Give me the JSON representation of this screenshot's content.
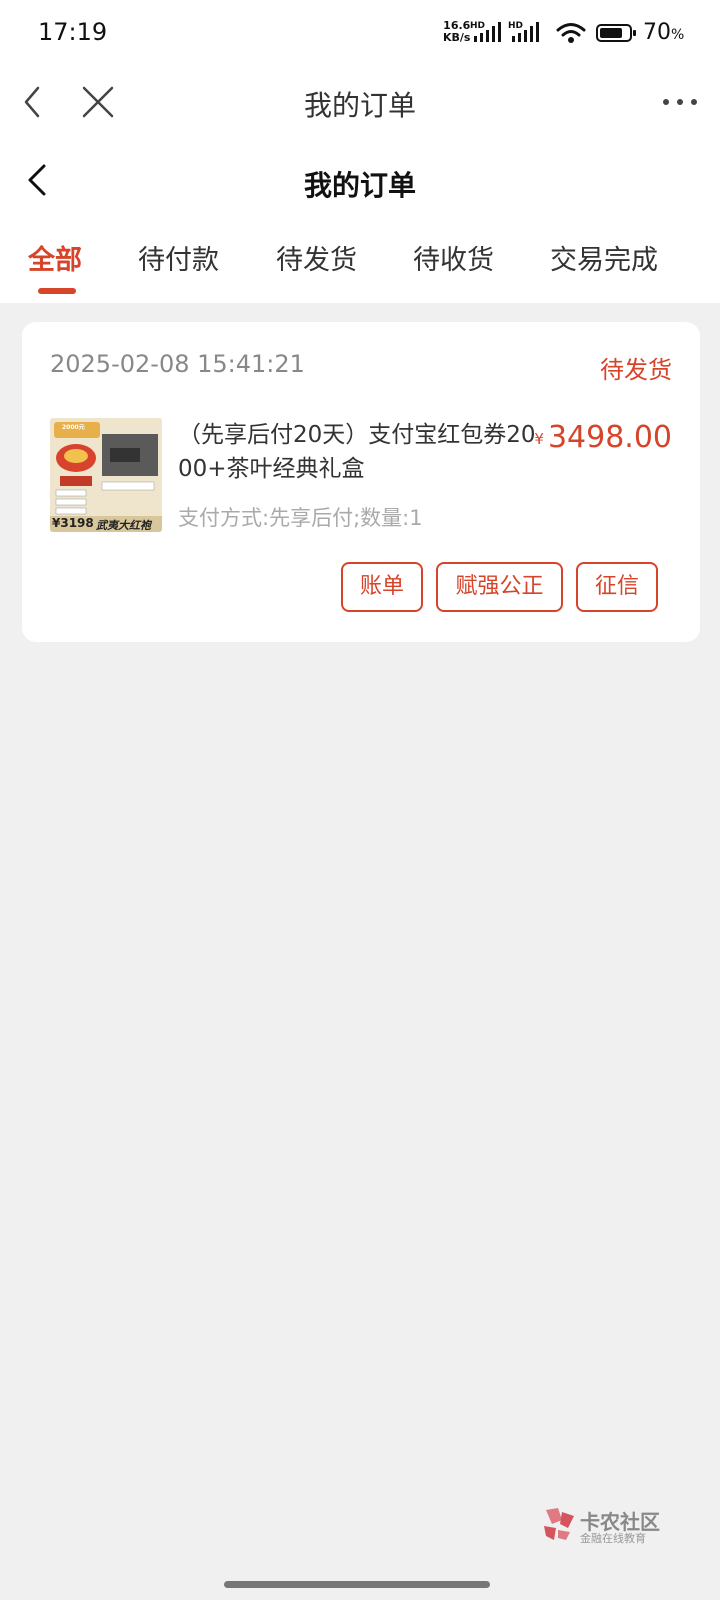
{
  "status_bar": {
    "time": "17:19",
    "net_speed_value": "16.6",
    "net_speed_unit": "KB/s",
    "battery_percent": "70",
    "battery_percent_sign": "%",
    "icons": [
      "hd-signal-icon",
      "hd-signal-icon",
      "wifi-icon",
      "battery-icon"
    ]
  },
  "browser_bar": {
    "title": "我的订单",
    "icons": [
      "back-icon",
      "close-icon",
      "more-icon"
    ]
  },
  "page_header": {
    "title": "我的订单"
  },
  "tabs": [
    {
      "label": "全部",
      "active": true
    },
    {
      "label": "待付款",
      "active": false
    },
    {
      "label": "待发货",
      "active": false
    },
    {
      "label": "待收货",
      "active": false
    },
    {
      "label": "交易完成",
      "active": false
    }
  ],
  "order": {
    "date": "2025-02-08 15:41:21",
    "status": "待发货",
    "product_name": "（先享后付20天）支付宝红包券2000+茶叶经典礼盒",
    "currency_symbol": "¥",
    "price": "3498.00",
    "meta": "支付方式:先享后付;数量:1",
    "thumbnail": {
      "price_label": "¥3198",
      "title_label": "武夷大红袍",
      "badge": "2000元"
    },
    "actions": [
      {
        "label": "账单"
      },
      {
        "label": "赋强公正"
      },
      {
        "label": "征信"
      }
    ]
  },
  "watermark": {
    "title": "卡农社区",
    "subtitle": "金融在线教育"
  },
  "colors": {
    "accent": "#d6442a",
    "page_bg": "#f0f0f0",
    "card_bg": "#ffffff"
  }
}
